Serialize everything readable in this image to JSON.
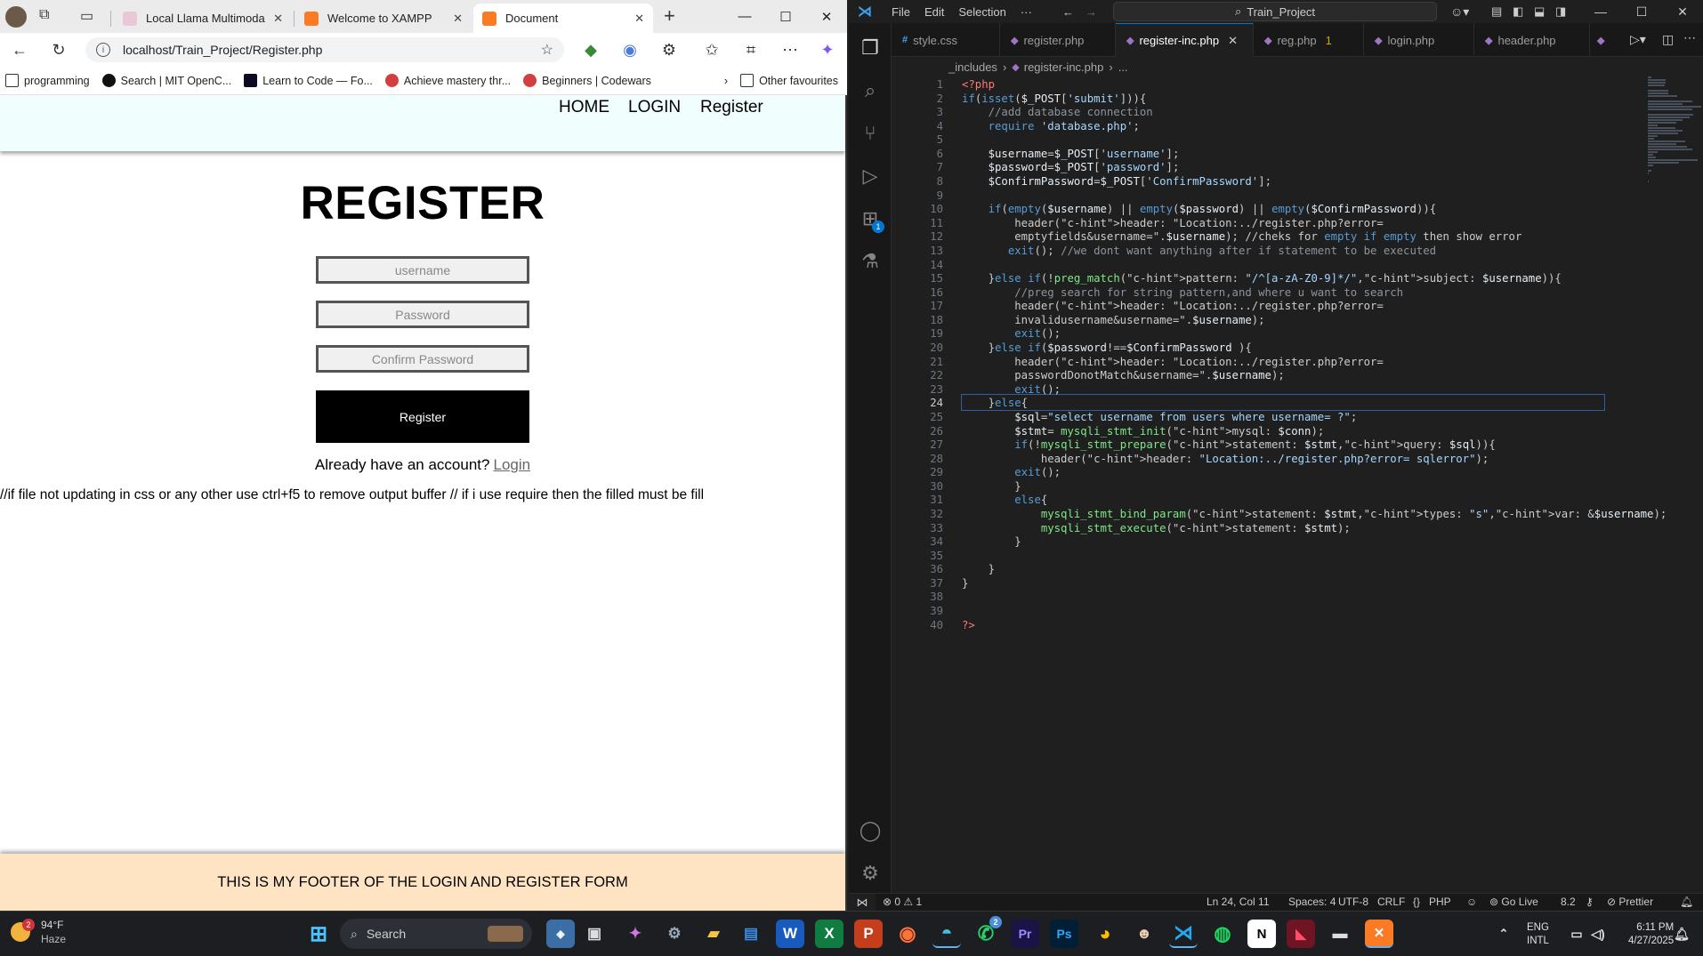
{
  "browser": {
    "tabs": [
      {
        "label": "Local Llama Multimoda",
        "active": false
      },
      {
        "label": "Welcome to XAMPP",
        "active": false
      },
      {
        "label": "Document",
        "active": true
      }
    ],
    "url": "localhost/Train_Project/Register.php",
    "favourites": [
      "programming",
      "Search | MIT OpenC...",
      "Learn to Code — Fo...",
      "Achieve mastery thr...",
      "Beginners | Codewars"
    ],
    "other_favourites": "Other favourites"
  },
  "site": {
    "nav": {
      "home": "HOME",
      "login": "LOGIN",
      "register": "Register"
    },
    "title": "REGISTER",
    "form": {
      "username_placeholder": "username",
      "password_placeholder": "Password",
      "confirm_placeholder": "Confirm Password",
      "submit_label": "Register"
    },
    "account_prompt": "Already have an account?",
    "login_link": "Login",
    "note": "//if file not updating in css or any other use ctrl+f5 to remove output buffer // if i use require then the filled must be fill",
    "footer": "THIS IS MY FOOTER OF THE LOGIN AND REGISTER FORM"
  },
  "vscode": {
    "menu": [
      "File",
      "Edit",
      "Selection",
      "···"
    ],
    "search": "Train_Project",
    "tabs": [
      {
        "label": "style.css",
        "icon": "#",
        "active": false
      },
      {
        "label": "register.php",
        "icon": "php",
        "active": false
      },
      {
        "label": "register-inc.php",
        "icon": "php",
        "active": true
      },
      {
        "label": "reg.php",
        "icon": "php",
        "active": false,
        "problems": "1"
      },
      {
        "label": "login.php",
        "icon": "php",
        "active": false
      },
      {
        "label": "header.php",
        "icon": "php",
        "active": false
      }
    ],
    "breadcrumb": [
      "_includes",
      "register-inc.php",
      "..."
    ],
    "current_line": 24,
    "code_lines": [
      "<?php",
      "if(isset($_POST['submit'])){",
      "    //add database connection",
      "    require 'database.php';",
      "",
      "    $username=$_POST['username'];",
      "    $password=$_POST['password'];",
      "    $ConfirmPassword=$_POST['ConfirmPassword'];",
      "",
      "    if(empty($username) || empty($password) || empty($ConfirmPassword)){",
      "        header(header: \"Location:../register.php?error=",
      "        emptyfields&username=\".$username); //cheks for empty if empty then show error",
      "       exit(); //we dont want anything after if statement to be executed",
      "",
      "    }else if(!preg_match(pattern: \"/^[a-zA-Z0-9]*/\",subject: $username)){",
      "        //preg search for string pattern,and where u want to search",
      "        header(header: \"Location:../register.php?error=",
      "        invalidusername&username=\".$username);",
      "        exit();",
      "    }else if($password!==$ConfirmPassword ){",
      "        header(header: \"Location:../register.php?error=",
      "        passwordDonotMatch&username=\".$username);",
      "        exit();",
      "    }else{",
      "        $sql=\"select username from users where username= ?\";",
      "        $stmt= mysqli_stmt_init(mysql: $conn);",
      "        if(!mysqli_stmt_prepare(statement: $stmt,query: $sql)){",
      "            header(header: \"Location:../register.php?error= sqlerror\");",
      "        exit();",
      "        }",
      "        else{",
      "            mysqli_stmt_bind_param(statement: $stmt,types: \"s\",var: &$username);",
      "            mysqli_stmt_execute(statement: $stmt);",
      "        }",
      "",
      "    }",
      "}",
      "",
      "",
      "?>"
    ],
    "status": {
      "problems": "⊗ 0 ⚠ 1",
      "position": "Ln 24, Col 11",
      "spaces": "Spaces: 4",
      "encoding": "UTF-8",
      "eol": "CRLF",
      "language": "PHP",
      "golive": "Go Live",
      "version": "8.2",
      "prettier": "Prettier"
    }
  },
  "taskbar": {
    "weather_temp": "94°F",
    "weather_desc": "Haze",
    "weather_badge": "2",
    "search_placeholder": "Search",
    "lang_top": "ENG",
    "lang_bottom": "INTL",
    "time": "6:11 PM",
    "date": "4/27/2025"
  },
  "colors": {
    "nav_bg": "#f0fffe",
    "footer_bg": "#ffe4c4",
    "vscode_bg": "#1f1f1f",
    "accent": "#0078d4"
  }
}
